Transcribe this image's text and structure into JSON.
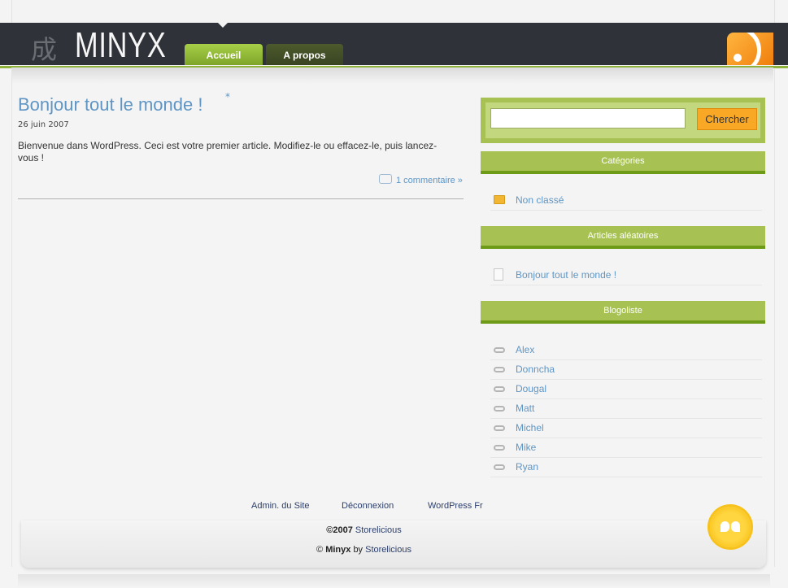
{
  "header": {
    "logo_kanji": "成",
    "logo_text": "MINYX",
    "nav": [
      {
        "label": "Accueil"
      },
      {
        "label": "A propos"
      }
    ]
  },
  "post": {
    "title": "Bonjour tout le monde !",
    "title_mark": "*",
    "date": "26 juin 2007",
    "body": "Bienvenue dans WordPress. Ceci est votre premier article. Modifiez-le ou effacez-le, puis lancez-vous !",
    "comments_link": "1 commentaire »"
  },
  "sidebar": {
    "search": {
      "value": "",
      "button_label": "Chercher"
    },
    "widgets": [
      {
        "title": "Catégories",
        "icon": "folder-icon",
        "items": [
          "Non classé"
        ]
      },
      {
        "title": "Articles aléatoires",
        "icon": "page-icon",
        "items": [
          "Bonjour tout le monde !"
        ]
      },
      {
        "title": "Blogoliste",
        "icon": "link-icon",
        "items": [
          "Alex",
          "Donncha",
          "Dougal",
          "Matt",
          "Michel",
          "Mike",
          "Ryan"
        ]
      }
    ]
  },
  "footer": {
    "links": [
      "Admin. du Site",
      "Déconnexion",
      "WordPress Fr"
    ],
    "copyright_prefix": "©2007",
    "copyright_link": "Storelicious",
    "credit_prefix": "©",
    "credit_theme": "Minyx",
    "credit_by": "by",
    "credit_link": "Storelicious"
  },
  "colors": {
    "header_bg": "#2f3339",
    "accent_green": "#a7c253",
    "link_blue": "#5f95c4",
    "button_orange": "#f9a825"
  }
}
